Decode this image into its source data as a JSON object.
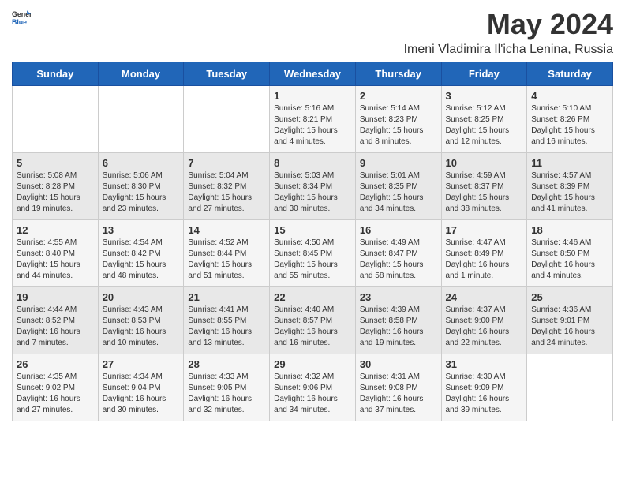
{
  "logo": {
    "general": "General",
    "blue": "Blue"
  },
  "title": "May 2024",
  "subtitle": "Imeni Vladimira Il'icha Lenina, Russia",
  "days_of_week": [
    "Sunday",
    "Monday",
    "Tuesday",
    "Wednesday",
    "Thursday",
    "Friday",
    "Saturday"
  ],
  "weeks": [
    [
      {
        "day": "",
        "info": ""
      },
      {
        "day": "",
        "info": ""
      },
      {
        "day": "",
        "info": ""
      },
      {
        "day": "1",
        "info": "Sunrise: 5:16 AM\nSunset: 8:21 PM\nDaylight: 15 hours\nand 4 minutes."
      },
      {
        "day": "2",
        "info": "Sunrise: 5:14 AM\nSunset: 8:23 PM\nDaylight: 15 hours\nand 8 minutes."
      },
      {
        "day": "3",
        "info": "Sunrise: 5:12 AM\nSunset: 8:25 PM\nDaylight: 15 hours\nand 12 minutes."
      },
      {
        "day": "4",
        "info": "Sunrise: 5:10 AM\nSunset: 8:26 PM\nDaylight: 15 hours\nand 16 minutes."
      }
    ],
    [
      {
        "day": "5",
        "info": "Sunrise: 5:08 AM\nSunset: 8:28 PM\nDaylight: 15 hours\nand 19 minutes."
      },
      {
        "day": "6",
        "info": "Sunrise: 5:06 AM\nSunset: 8:30 PM\nDaylight: 15 hours\nand 23 minutes."
      },
      {
        "day": "7",
        "info": "Sunrise: 5:04 AM\nSunset: 8:32 PM\nDaylight: 15 hours\nand 27 minutes."
      },
      {
        "day": "8",
        "info": "Sunrise: 5:03 AM\nSunset: 8:34 PM\nDaylight: 15 hours\nand 30 minutes."
      },
      {
        "day": "9",
        "info": "Sunrise: 5:01 AM\nSunset: 8:35 PM\nDaylight: 15 hours\nand 34 minutes."
      },
      {
        "day": "10",
        "info": "Sunrise: 4:59 AM\nSunset: 8:37 PM\nDaylight: 15 hours\nand 38 minutes."
      },
      {
        "day": "11",
        "info": "Sunrise: 4:57 AM\nSunset: 8:39 PM\nDaylight: 15 hours\nand 41 minutes."
      }
    ],
    [
      {
        "day": "12",
        "info": "Sunrise: 4:55 AM\nSunset: 8:40 PM\nDaylight: 15 hours\nand 44 minutes."
      },
      {
        "day": "13",
        "info": "Sunrise: 4:54 AM\nSunset: 8:42 PM\nDaylight: 15 hours\nand 48 minutes."
      },
      {
        "day": "14",
        "info": "Sunrise: 4:52 AM\nSunset: 8:44 PM\nDaylight: 15 hours\nand 51 minutes."
      },
      {
        "day": "15",
        "info": "Sunrise: 4:50 AM\nSunset: 8:45 PM\nDaylight: 15 hours\nand 55 minutes."
      },
      {
        "day": "16",
        "info": "Sunrise: 4:49 AM\nSunset: 8:47 PM\nDaylight: 15 hours\nand 58 minutes."
      },
      {
        "day": "17",
        "info": "Sunrise: 4:47 AM\nSunset: 8:49 PM\nDaylight: 16 hours\nand 1 minute."
      },
      {
        "day": "18",
        "info": "Sunrise: 4:46 AM\nSunset: 8:50 PM\nDaylight: 16 hours\nand 4 minutes."
      }
    ],
    [
      {
        "day": "19",
        "info": "Sunrise: 4:44 AM\nSunset: 8:52 PM\nDaylight: 16 hours\nand 7 minutes."
      },
      {
        "day": "20",
        "info": "Sunrise: 4:43 AM\nSunset: 8:53 PM\nDaylight: 16 hours\nand 10 minutes."
      },
      {
        "day": "21",
        "info": "Sunrise: 4:41 AM\nSunset: 8:55 PM\nDaylight: 16 hours\nand 13 minutes."
      },
      {
        "day": "22",
        "info": "Sunrise: 4:40 AM\nSunset: 8:57 PM\nDaylight: 16 hours\nand 16 minutes."
      },
      {
        "day": "23",
        "info": "Sunrise: 4:39 AM\nSunset: 8:58 PM\nDaylight: 16 hours\nand 19 minutes."
      },
      {
        "day": "24",
        "info": "Sunrise: 4:37 AM\nSunset: 9:00 PM\nDaylight: 16 hours\nand 22 minutes."
      },
      {
        "day": "25",
        "info": "Sunrise: 4:36 AM\nSunset: 9:01 PM\nDaylight: 16 hours\nand 24 minutes."
      }
    ],
    [
      {
        "day": "26",
        "info": "Sunrise: 4:35 AM\nSunset: 9:02 PM\nDaylight: 16 hours\nand 27 minutes."
      },
      {
        "day": "27",
        "info": "Sunrise: 4:34 AM\nSunset: 9:04 PM\nDaylight: 16 hours\nand 30 minutes."
      },
      {
        "day": "28",
        "info": "Sunrise: 4:33 AM\nSunset: 9:05 PM\nDaylight: 16 hours\nand 32 minutes."
      },
      {
        "day": "29",
        "info": "Sunrise: 4:32 AM\nSunset: 9:06 PM\nDaylight: 16 hours\nand 34 minutes."
      },
      {
        "day": "30",
        "info": "Sunrise: 4:31 AM\nSunset: 9:08 PM\nDaylight: 16 hours\nand 37 minutes."
      },
      {
        "day": "31",
        "info": "Sunrise: 4:30 AM\nSunset: 9:09 PM\nDaylight: 16 hours\nand 39 minutes."
      },
      {
        "day": "",
        "info": ""
      }
    ]
  ],
  "colors": {
    "header_bg": "#2166b8",
    "header_text": "#ffffff",
    "odd_row": "#f5f5f5",
    "even_row": "#e8e8e8"
  }
}
